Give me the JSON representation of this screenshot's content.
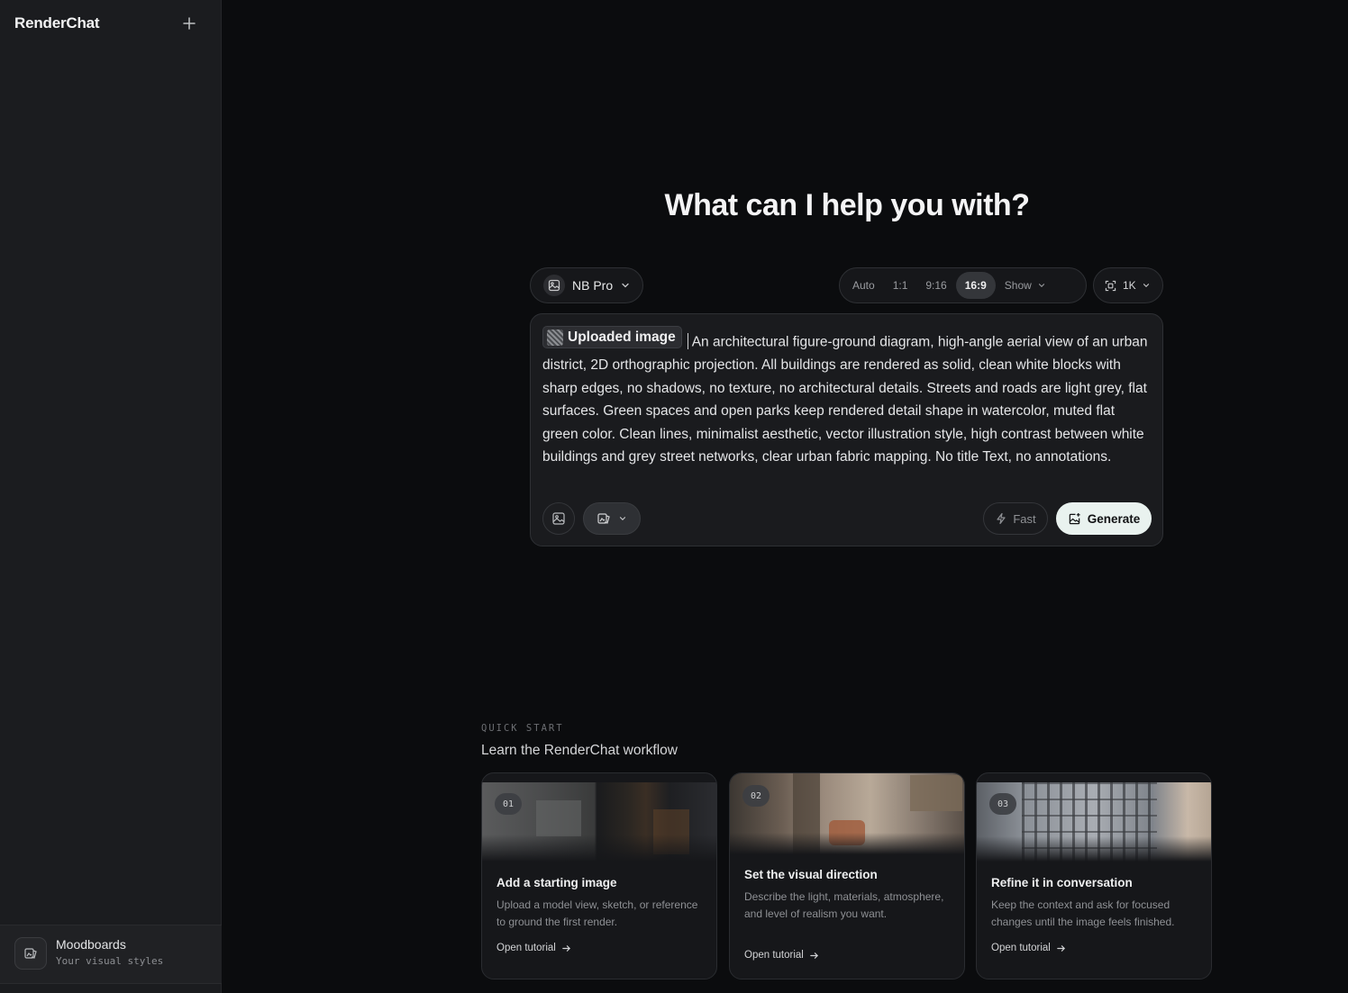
{
  "sidebar": {
    "brand": "RenderChat",
    "new_chat_icon": "plus-icon",
    "footer": {
      "title": "Moodboards",
      "subtitle": "Your visual styles",
      "icon": "moodboard-icon"
    }
  },
  "main": {
    "heading": "What can I help you with?",
    "model": {
      "label": "NB Pro",
      "icon": "image-icon"
    },
    "aspect_ratios": {
      "options": [
        "Auto",
        "1:1",
        "9:16",
        "16:9"
      ],
      "selected": "16:9",
      "show_label": "Show"
    },
    "resolution": {
      "label": "1K",
      "icon": "expand-icon"
    },
    "prompt": {
      "chip_label": "Uploaded image",
      "text": "An architectural figure-ground diagram, high-angle aerial view of an urban district, 2D orthographic projection. All buildings are rendered as solid, clean white blocks with sharp edges, no shadows, no texture, no architectural details. Streets and roads are light grey, flat surfaces. Green spaces and open parks keep rendered detail shape in watercolor, muted flat green color. Clean lines, minimalist aesthetic, vector illustration style, high contrast between white buildings and grey street networks, clear urban fabric mapping. No title Text, no annotations."
    },
    "toolbar": {
      "fast_label": "Fast",
      "generate_label": "Generate"
    }
  },
  "quick_start": {
    "label": "QUICK START",
    "title": "Learn the RenderChat workflow",
    "cards": [
      {
        "num": "01",
        "title": "Add a starting image",
        "desc": "Upload a model view, sketch, or reference to ground the first render.",
        "link": "Open tutorial"
      },
      {
        "num": "02",
        "title": "Set the visual direction",
        "desc": "Describe the light, materials, atmosphere, and level of realism you want.",
        "link": "Open tutorial"
      },
      {
        "num": "03",
        "title": "Refine it in conversation",
        "desc": "Keep the context and ask for focused changes until the image feels finished.",
        "link": "Open tutorial"
      }
    ]
  },
  "colors": {
    "accent_button": "#e9f2ef",
    "background": "#0b0c0e",
    "sidebar": "#1b1c1f"
  }
}
